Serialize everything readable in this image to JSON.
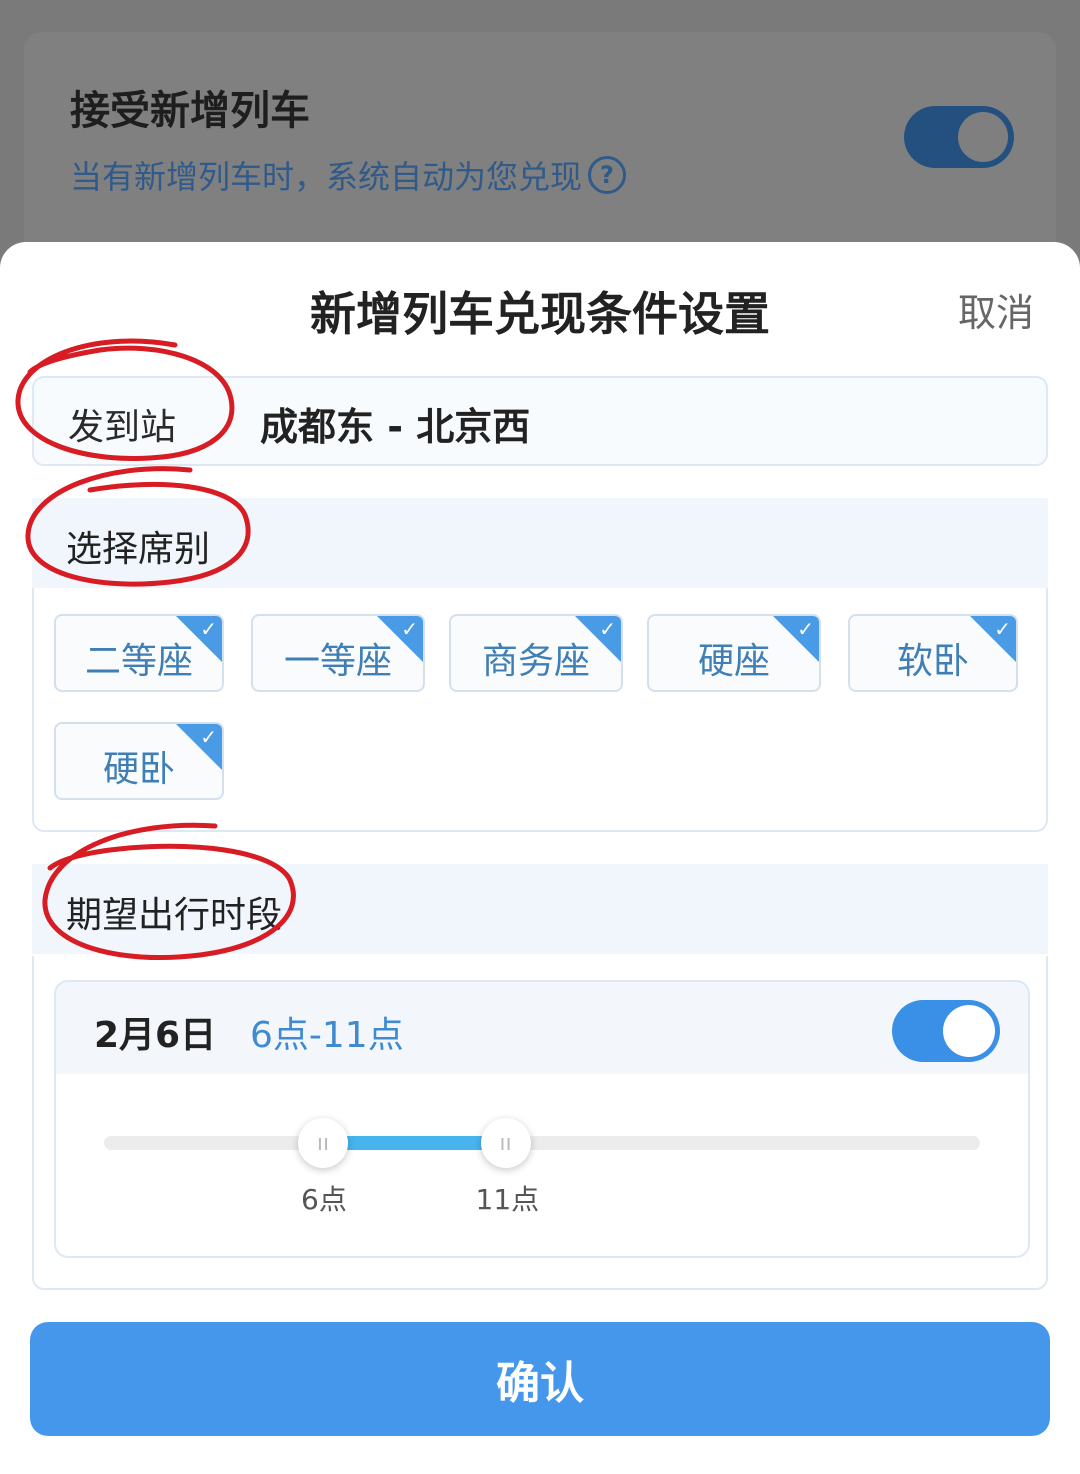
{
  "background": {
    "title": "接受新增列车",
    "subtitle": "当有新增列车时，系统自动为您兑现",
    "help_icon": "?"
  },
  "sheet": {
    "title": "新增列车兑现条件设置",
    "cancel_label": "取消",
    "station": {
      "label": "发到站",
      "value": "成都东 - 北京西"
    },
    "seat_section": {
      "label": "选择席别",
      "options": [
        {
          "label": "二等座",
          "selected": true
        },
        {
          "label": "一等座",
          "selected": true
        },
        {
          "label": "商务座",
          "selected": true
        },
        {
          "label": "硬座",
          "selected": true
        },
        {
          "label": "软卧",
          "selected": true
        },
        {
          "label": "硬卧",
          "selected": true
        }
      ]
    },
    "time_section": {
      "label": "期望出行时段",
      "date": "2月6日",
      "range_text": "6点-11点",
      "enabled": true,
      "slider": {
        "start": 6,
        "end": 11,
        "start_label": "6点",
        "end_label": "11点"
      }
    },
    "confirm_label": "确认"
  },
  "colors": {
    "accent": "#4597ec",
    "annotation": "#d81c24"
  }
}
